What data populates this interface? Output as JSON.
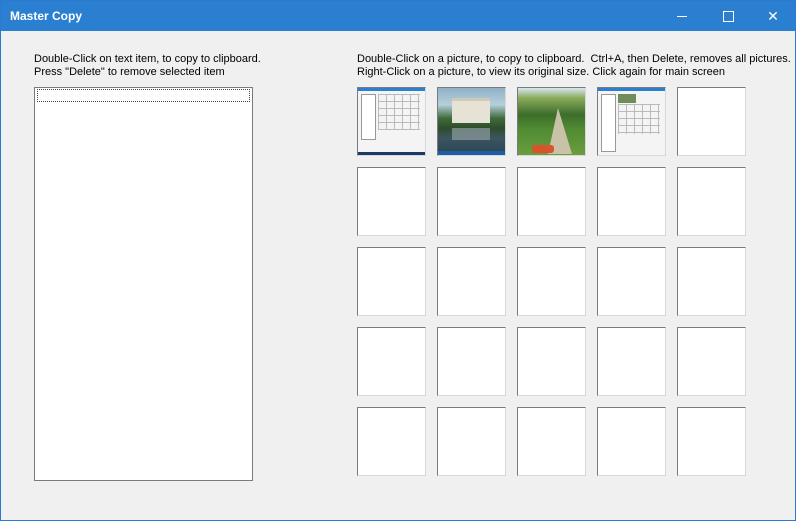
{
  "window": {
    "title": "Master Copy"
  },
  "controls": {
    "minimize": "minimize",
    "maximize": "maximize",
    "close": "✕"
  },
  "instructions": {
    "left": "Double-Click on text item, to copy to clipboard.\nPress \"Delete\" to remove selected item",
    "right": "Double-Click on a picture, to copy to clipboard.  Ctrl+A, then Delete, removes all pictures.\nRight-Click on a picture, to view its original size. Click again for main screen"
  },
  "text_list": {
    "items": []
  },
  "picture_grid": {
    "rows": 5,
    "cols": 5,
    "thumbnails": [
      {
        "index": 0,
        "content": "screenshot-of-app"
      },
      {
        "index": 1,
        "content": "palace-by-lake-photo"
      },
      {
        "index": 2,
        "content": "park-path-photo"
      },
      {
        "index": 3,
        "content": "screenshot-of-app"
      }
    ]
  }
}
